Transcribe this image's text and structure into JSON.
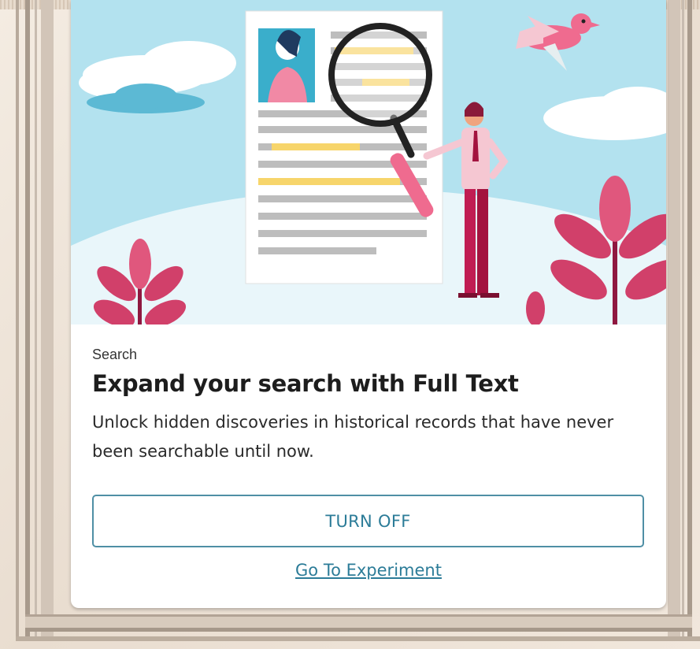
{
  "card": {
    "eyebrow": "Search",
    "title": "Expand your search with Full Text",
    "description": "Unlock hidden discoveries in historical records that have never been searchable until now.",
    "primary_button_label": "TURN OFF",
    "link_label": "Go To Experiment"
  },
  "colors": {
    "accent": "#2c7c98",
    "button_border": "#4f8fa5",
    "hero_sky": "#b3e2ef",
    "highlight": "#f7d56b",
    "leaf_pink": "#d1406a"
  },
  "icons": {
    "hero": "search-illustration",
    "magnifier": "magnifying-glass-icon"
  }
}
